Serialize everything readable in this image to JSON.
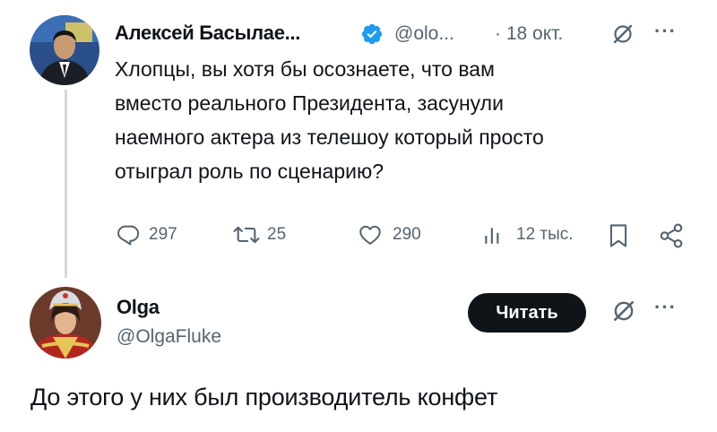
{
  "tweet": {
    "author_name": "Алексей Басылае...",
    "handle": "@olo...",
    "date": "· 18 окт.",
    "text_lines": [
      "Хлопцы, вы хотя бы осознаете, что вам",
      "вместо реального Президента, засунули",
      "наемного актера из телешоу который просто",
      "отыграл роль по сценарию?"
    ],
    "actions": {
      "replies": "297",
      "retweets": "25",
      "likes": "290",
      "views": "12 тыс."
    },
    "more": "···"
  },
  "reply": {
    "author_name": "Olga",
    "handle": "@OlgaFluke",
    "follow_label": "Читать",
    "more": "···",
    "text": "До этого у них был производитель конфет"
  },
  "colors": {
    "text": "#0f1419",
    "secondary": "#536471",
    "verified": "#1d9bf0",
    "button_bg": "#0f1419",
    "thread_line": "#cfd9de"
  }
}
